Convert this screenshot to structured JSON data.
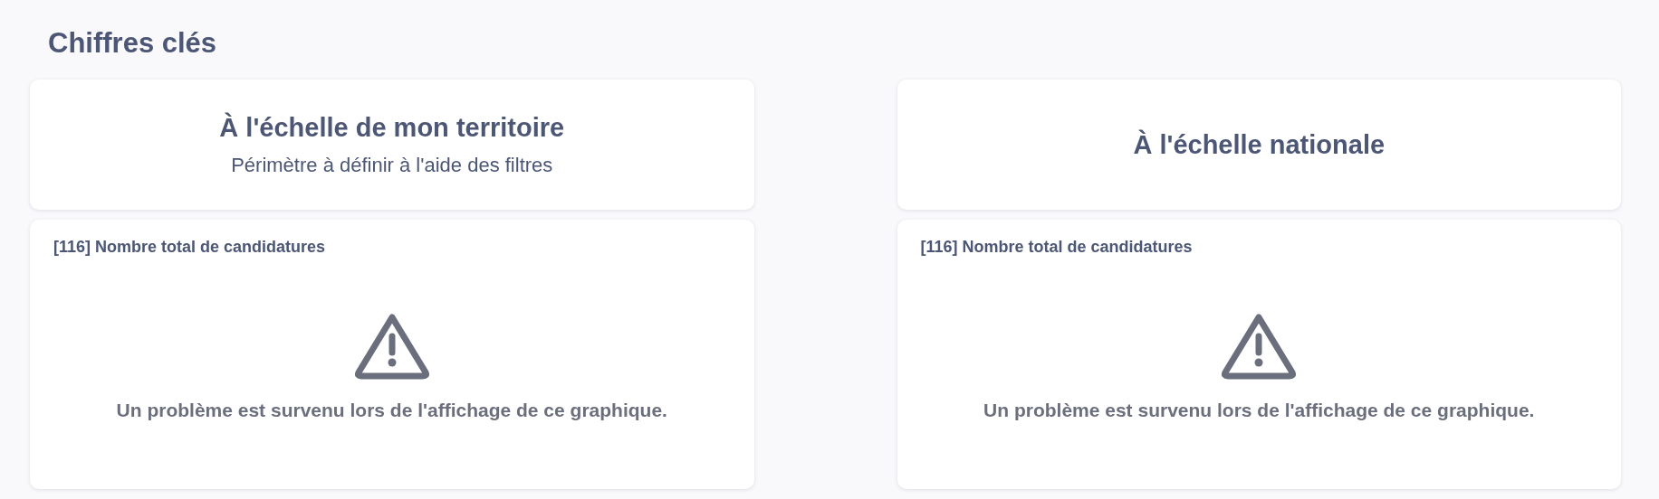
{
  "title": "Chiffres clés",
  "columns": [
    {
      "header": {
        "title": "À l'échelle de mon territoire",
        "subtitle": "Périmètre à définir à l'aide des filtres"
      },
      "card": {
        "title": "[116] Nombre total de candidatures",
        "error": "Un problème est survenu lors de l'affichage de ce graphique."
      }
    },
    {
      "header": {
        "title": "À l'échelle nationale"
      },
      "card": {
        "title": "[116] Nombre total de candidatures",
        "error": "Un problème est survenu lors de l'affichage de ce graphique."
      }
    }
  ]
}
